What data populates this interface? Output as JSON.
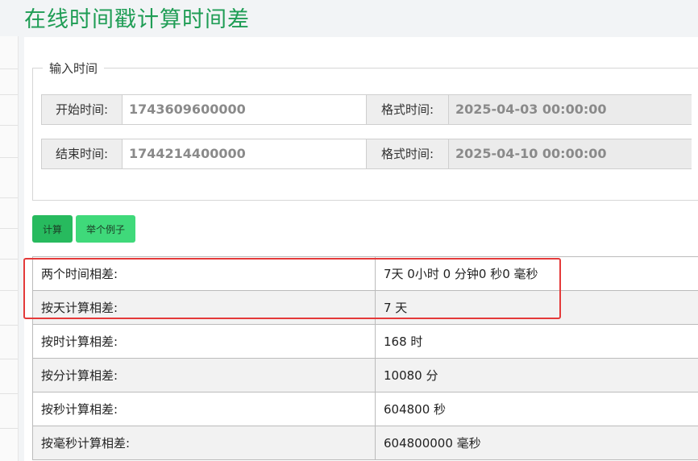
{
  "page": {
    "title": "在线时间戳计算时间差"
  },
  "input_group": {
    "legend": "输入时间",
    "start": {
      "label": "开始时间:",
      "value": "1743609600000",
      "format_label": "格式时间:",
      "format_value": "2025-04-03 00:00:00"
    },
    "end": {
      "label": "结束时间:",
      "value": "1744214400000",
      "format_label": "格式时间:",
      "format_value": "2025-04-10 00:00:00"
    }
  },
  "buttons": {
    "calculate": "计算",
    "example": "举个例子"
  },
  "results": [
    {
      "label": "两个时间相差:",
      "value": "7天 0小时 0 分钟0 秒0 毫秒"
    },
    {
      "label": "按天计算相差:",
      "value": "7 天"
    },
    {
      "label": "按时计算相差:",
      "value": "168 时"
    },
    {
      "label": "按分计算相差:",
      "value": "10080 分"
    },
    {
      "label": "按秒计算相差:",
      "value": "604800 秒"
    },
    {
      "label": "按毫秒计算相差:",
      "value": "604800000 毫秒"
    }
  ],
  "colors": {
    "title": "#1f9d55",
    "calculate_button": "#27ba5e",
    "example_button": "#3fd97a",
    "highlight_border": "#e43a3a"
  }
}
